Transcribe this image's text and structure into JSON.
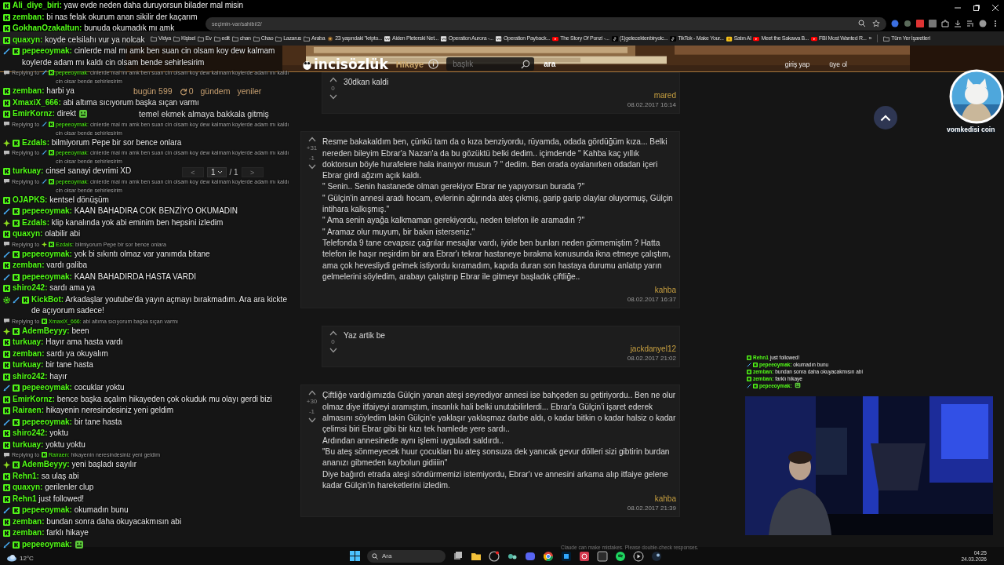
{
  "browser": {
    "url": "seçimin-var/sahibi/2/",
    "bookmarks": [
      {
        "label": "Vidya",
        "kind": "folder"
      },
      {
        "label": "Kişisel",
        "kind": "folder"
      },
      {
        "label": "Ev",
        "kind": "folder"
      },
      {
        "label": "edit",
        "kind": "folder"
      },
      {
        "label": "chan",
        "kind": "folder"
      },
      {
        "label": "Chao",
        "kind": "folder"
      },
      {
        "label": "Lazarus",
        "kind": "folder"
      },
      {
        "label": "Araba",
        "kind": "folder"
      },
      {
        "label": "23 yaşındaki \"kripto...",
        "kind": "page"
      },
      {
        "label": "Aiden Pleterski Net...",
        "kind": "wiki"
      },
      {
        "label": "Operation Aurora -...",
        "kind": "wiki"
      },
      {
        "label": "Operation Payback...",
        "kind": "wiki"
      },
      {
        "label": "The Story Of Ponzi -...",
        "kind": "video"
      },
      {
        "label": "(1)gelecektenbiryolc...",
        "kind": "tiktok"
      },
      {
        "label": "TikTok - Make Your...",
        "kind": "tiktok"
      },
      {
        "label": "Satın Al",
        "kind": "coin"
      },
      {
        "label": "Meet the Sakawa B...",
        "kind": "video"
      },
      {
        "label": "FBI Most Wanted R...",
        "kind": "video"
      }
    ],
    "overflow": "»",
    "all_bookmarks": "Tüm Yer İşaretleri"
  },
  "site": {
    "logo": "incisözlük",
    "section": "Hikaye",
    "search": {
      "placeholder": "başlık"
    },
    "search_button": "ara",
    "nav": [
      "giriş yap",
      "üye ol"
    ]
  },
  "sidebar": {
    "today_label": "bugün 599",
    "refresh_count": "0",
    "links": [
      "gündem",
      "yeniler"
    ],
    "topics": [
      "temel ekmek almaya bakkala gitmiş"
    ],
    "pagination": {
      "prev": "<",
      "page": "1",
      "total": "/ 1",
      "next": ">"
    }
  },
  "entries": [
    {
      "kind": "reply",
      "score": "0",
      "paragraphs": [
        "30dkan kaldi"
      ],
      "author": "mared",
      "date": "08.02.2017 16:14"
    },
    {
      "kind": "entry",
      "plus": "+31",
      "minus": "-1",
      "paragraphs": [
        "Resme bakakaldım ben, çünkü tam da o kıza benziyordu, rüyamda, odada gördüğüm kıza... Belki nereden bileyim Ebrar'a Nazan'a da bu gözüktü belki dedim.. içimdende \" Kahba kaç yıllık doktorsun böyle hurafelere hala inanıyor musun ? \" dedim. Ben orada oyalanırken odadan içeri Ebrar girdi ağzım açık kaldı.",
        "\" Senin.. Senin hastanede olman gerekiyor Ebrar ne yapıyorsun burada ?\"",
        "\" Gülçin'in annesi aradı hocam, evlerinin ağırında ateş çıkmış, garip garip olaylar oluyormuş, Gülçin intihara kalkışmış.\"",
        "\" Ama senin ayağa kalkmaman gerekiyordu, neden telefon ile aramadın ?\"",
        "\" Aramaz olur muyum, bir bakın isterseniz.\"",
        "Telefonda 9 tane cevapsız çağrılar mesajlar vardı, iyide ben bunları neden görmemiştim ? Hatta telefon ile haşır neşirdim bir ara Ebrar'ı tekrar hastaneye bırakma konusunda ikna etmeye çalıştım, ama çok hevesliydi gelmek istiyordu kıramadım, kapıda duran son hastaya durumu anlatıp yarın gelmelerini söyledim, arabayı çalıştırıp Ebrar ile gitmeyr başladık çiftliğe.."
      ],
      "author": "kahba",
      "date": "08.02.2017 16:37"
    },
    {
      "kind": "reply",
      "score": "0",
      "paragraphs": [
        "Yaz artik be"
      ],
      "author": "jackdanyel12",
      "date": "08.02.2017 21:02"
    },
    {
      "kind": "entry",
      "plus": "+30",
      "minus": "-1",
      "paragraphs": [
        "Çiftliğe vardığımızda Gülçin yanan ateşi seyrediyor annesi ise bahçeden su getiriyordu.. Ben ne olur olmaz diye itfaiyeyi aramıştım, insanlık hali belki unutabilirlerdi... Ebrar'a Gülçin'i işaret ederek almasını söyledim lakin Gülçin'e yaklaşır yaklaşmaz darbe aldı, o kadar bitkin o kadar halsiz o kadar çelimsi biri Ebrar gibi bir kızı tek hamlede yere sardı..",
        "Ardından annesinede aynı işlemi uyguladı saldırdı..",
        "\"Bu ateş sönmeyecek huur çocukları bu ateş sonsuza dek yanıcak gevur dölleri sizi gibtirin burdan ananızı gibmeden kaybolun gidiiiin\"",
        "Diye bağırdı etrada ateşi söndürmemizi istemiyordu, Ebrar'ı ve annesini arkama alıp itfaiye gelene kadar Gülçin'in hareketlerini izledim."
      ],
      "author": "kahba",
      "date": "08.02.2017 21:39"
    }
  ],
  "chat": [
    {
      "kind": "message",
      "bot": false,
      "sword": false,
      "star": false,
      "user": "Ali_diye_biri:",
      "text": "yaw evde neden daha duruyorsun bilader mal misin"
    },
    {
      "kind": "message",
      "bot": false,
      "sword": false,
      "star": false,
      "user": "zemban:",
      "text": "bi nas felak okurum anan sikilir der kaçarım"
    },
    {
      "kind": "message",
      "bot": false,
      "sword": false,
      "star": false,
      "user": "GokhanOzakaltun:",
      "text": "bunuda okumadık mı amk"
    },
    {
      "kind": "message",
      "bot": false,
      "sword": false,
      "star": false,
      "user": "quaxyn:",
      "text": "koyde celsilahı vur ya nolcak"
    },
    {
      "kind": "message",
      "bot": false,
      "sword": true,
      "star": false,
      "user": "pepeeoymak:",
      "text": "cinlerde mal mı amk ben suan cin olsam koy dew kalmam koylerde adam mı kaldı cin olsam bende sehirlesirim"
    },
    {
      "kind": "reply",
      "label": "Replying to",
      "bot": false,
      "sword": true,
      "star": false,
      "user": "pepeeoymak:",
      "text": "cinlerde mal mı amk ben suan cin olsam koy dew kalmam koylerde adam mı kaldı cin olsar bende sehirlesirim"
    },
    {
      "kind": "message",
      "bot": false,
      "sword": false,
      "star": false,
      "user": "zemban:",
      "text": "harbi ya"
    },
    {
      "kind": "message",
      "bot": false,
      "sword": false,
      "star": false,
      "user": "XmaxiX_666:",
      "text": "abi altıma sıcıyorum başka sıçan varmı"
    },
    {
      "kind": "emote",
      "bot": false,
      "sword": false,
      "star": false,
      "user": "EmirKornz:",
      "text": "direkt"
    },
    {
      "kind": "reply",
      "label": "Replying to",
      "bot": false,
      "sword": true,
      "star": false,
      "user": "pepeeoymak:",
      "text": "cinlerde mal mı amk ben suan cin olsam koy dew kalmam koylerde adam mı kaldı cin olsar bende sehirlesirim"
    },
    {
      "kind": "message",
      "bot": false,
      "sword": false,
      "star": true,
      "user": "Ezdals:",
      "text": "bilmiyorum Pepe bir sor bence onlara"
    },
    {
      "kind": "reply",
      "label": "Replying to",
      "bot": false,
      "sword": true,
      "star": false,
      "user": "pepeeoymak:",
      "text": "cinlerde mal mı amk ben suan cin olsam koy dew kalmam koylerde adam mı kaldı cin olsar bende sehirlesirim"
    },
    {
      "kind": "message",
      "bot": false,
      "sword": false,
      "star": false,
      "user": "turkuay:",
      "text": "cinsel sanayi devrimi XD"
    },
    {
      "kind": "reply",
      "label": "Replying to",
      "bot": false,
      "sword": true,
      "star": false,
      "user": "pepeeoymak:",
      "text": "cinlerde mal mı amk ben suan cin olsam koy dew kalmam koylerde adam mı kaldı cin olsar bende sehirlesirim"
    },
    {
      "kind": "message",
      "bot": false,
      "sword": false,
      "star": false,
      "user": "OJAPKS:",
      "text": "kentsel dönüşüm"
    },
    {
      "kind": "message",
      "bot": false,
      "sword": true,
      "star": false,
      "user": "pepeeoymak:",
      "text": "KAAN BAHADIRA COK BENZİYO OKUMADIN"
    },
    {
      "kind": "message",
      "bot": false,
      "sword": false,
      "star": true,
      "user": "Ezdals:",
      "text": "klip kanalında yok abi eminim ben hepsini izledim"
    },
    {
      "kind": "message",
      "bot": false,
      "sword": false,
      "star": false,
      "user": "quaxyn:",
      "text": "olabilir abi"
    },
    {
      "kind": "reply",
      "label": "Replying to",
      "bot": false,
      "sword": false,
      "star": true,
      "user": "Ezdals:",
      "text": "bilmiyorum Pepe bir sor bence onlara"
    },
    {
      "kind": "message",
      "bot": false,
      "sword": true,
      "star": false,
      "user": "pepeeoymak:",
      "text": "yok bi sıkıntı olmaz var yanımda bitane"
    },
    {
      "kind": "message",
      "bot": false,
      "sword": false,
      "star": false,
      "user": "zemban:",
      "text": "vardı galiba"
    },
    {
      "kind": "message",
      "bot": false,
      "sword": true,
      "star": false,
      "user": "pepeeoymak:",
      "text": "KAAN BAHADIRDA HASTA VARDI"
    },
    {
      "kind": "message",
      "bot": false,
      "sword": false,
      "star": false,
      "user": "shiro242:",
      "text": "sardı ama ya"
    },
    {
      "kind": "message",
      "bot": true,
      "sword": true,
      "star": false,
      "user": "KickBot:",
      "text": "Arkadaşlar youtube'da yayın açmayı bırakmadım. Ara ara kickte de açıyorum sadece!"
    },
    {
      "kind": "reply",
      "label": "Replying to",
      "bot": false,
      "sword": false,
      "star": false,
      "user": "XmaxiX_666:",
      "text": "abi altıma sıcıyorum başka sıçan varmı"
    },
    {
      "kind": "message",
      "bot": false,
      "sword": false,
      "star": true,
      "user": "AdemBeyyy:",
      "text": "been"
    },
    {
      "kind": "message",
      "bot": false,
      "sword": false,
      "star": false,
      "user": "turkuay:",
      "text": "Hayır ama hasta vardı"
    },
    {
      "kind": "message",
      "bot": false,
      "sword": false,
      "star": false,
      "user": "zemban:",
      "text": "sardı ya okuyalım"
    },
    {
      "kind": "message",
      "bot": false,
      "sword": false,
      "star": false,
      "user": "turkuay:",
      "text": "bir tane hasta"
    },
    {
      "kind": "message",
      "bot": false,
      "sword": false,
      "star": false,
      "user": "shiro242:",
      "text": "hayır"
    },
    {
      "kind": "message",
      "bot": false,
      "sword": true,
      "star": false,
      "user": "pepeeoymak:",
      "text": "cocuklar yoktu"
    },
    {
      "kind": "message",
      "bot": false,
      "sword": false,
      "star": false,
      "user": "EmirKornz:",
      "text": "bence başka açalım hikayeden çok okuduk mu olayı gerdi bizi"
    },
    {
      "kind": "message",
      "bot": false,
      "sword": false,
      "star": false,
      "user": "Rairaen:",
      "text": "hikayenin neresindesiniz yeni geldim"
    },
    {
      "kind": "message",
      "bot": false,
      "sword": true,
      "star": false,
      "user": "pepeeoymak:",
      "text": "bir tane hasta"
    },
    {
      "kind": "message",
      "bot": false,
      "sword": false,
      "star": false,
      "user": "shiro242:",
      "text": "yoktu"
    },
    {
      "kind": "message",
      "bot": false,
      "sword": false,
      "star": false,
      "user": "turkuay:",
      "text": "yoktu yoktu"
    },
    {
      "kind": "reply",
      "label": "Replying to",
      "bot": false,
      "sword": false,
      "star": false,
      "user": "Rairaen:",
      "text": "hikayenin neresindesiniz yeni geldim"
    },
    {
      "kind": "message",
      "bot": false,
      "sword": false,
      "star": true,
      "user": "AdemBeyyy:",
      "text": "yeni başladı sayılır"
    },
    {
      "kind": "message",
      "bot": false,
      "sword": false,
      "star": false,
      "user": "Rehn1:",
      "text": "sa ulaş abi"
    },
    {
      "kind": "message",
      "bot": false,
      "sword": false,
      "star": false,
      "user": "quaxyn:",
      "text": "gerilenler clup"
    },
    {
      "kind": "follow",
      "bot": false,
      "sword": false,
      "star": false,
      "user": "Rehn1",
      "text": "just followed!"
    },
    {
      "kind": "message",
      "bot": false,
      "sword": true,
      "star": false,
      "user": "pepeeoymak:",
      "text": "okumadın bunu"
    },
    {
      "kind": "message",
      "bot": false,
      "sword": false,
      "star": false,
      "user": "zemban:",
      "text": "bundan sonra daha okuyacakmısın abi"
    },
    {
      "kind": "message",
      "bot": false,
      "sword": false,
      "star": false,
      "user": "zemban:",
      "text": "farklı hikaye"
    },
    {
      "kind": "emote",
      "bot": false,
      "sword": true,
      "star": false,
      "user": "pepeeoymak:"
    }
  ],
  "overlay": {
    "avatar_caption": "vomkedisi coin"
  },
  "mini_chat": [
    {
      "kind": "follow",
      "bot": false,
      "sword": false,
      "star": false,
      "user": "Rehn1",
      "text": "just followed!"
    },
    {
      "kind": "message",
      "bot": false,
      "sword": true,
      "star": false,
      "user": "pepeeoymak:",
      "text": "okumadın bunu"
    },
    {
      "kind": "message",
      "bot": false,
      "sword": false,
      "star": false,
      "user": "zemban:",
      "text": "bundan sonra daha okuyacakmısın abi"
    },
    {
      "kind": "message",
      "bot": false,
      "sword": false,
      "star": false,
      "user": "zemban:",
      "text": "farklı hikaye"
    },
    {
      "kind": "emote",
      "bot": false,
      "sword": true,
      "star": false,
      "user": "pepeeoymak:"
    }
  ],
  "notice": "Claude can make mistakes. Please double-check responses.",
  "taskbar": {
    "weather": "12°C",
    "search": "Ara",
    "time": "04:25",
    "date": "24.03.2026"
  }
}
